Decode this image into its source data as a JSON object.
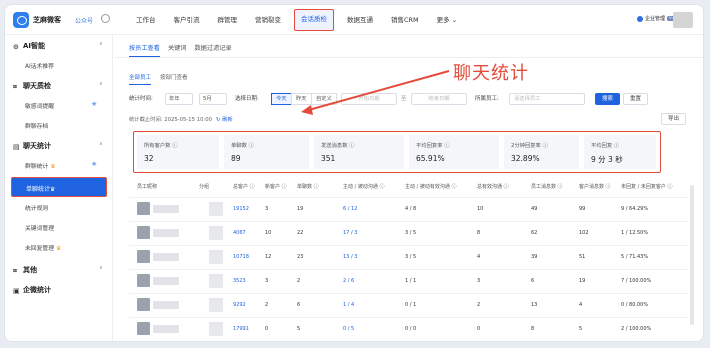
{
  "brand": {
    "name": "芝麻微客",
    "subtitle": "公众号"
  },
  "nav": [
    "工作台",
    "客户引流",
    "群管理",
    "营销裂变",
    "会话质检",
    "数据互通",
    "销售CRM",
    "更多 ⌄"
  ],
  "nav_active_index": 4,
  "user": {
    "name": "企业管理",
    "badge": "v3"
  },
  "sidebar": {
    "groups": [
      {
        "label": "AI智能",
        "items": [
          "AI话术推荐"
        ]
      },
      {
        "label": "聊天质检",
        "items": [
          "敏感词提醒",
          "群聊存档"
        ]
      },
      {
        "label": "聊天统计",
        "items": [
          "群聊统计",
          "单聊统计",
          "统计规则",
          "关键词管理",
          "未回复管理"
        ]
      },
      {
        "label": "其他",
        "items": []
      },
      {
        "label": "企微统计",
        "items": []
      }
    ],
    "active_item": "单聊统计"
  },
  "tabs": [
    "按员工查看",
    "关键词",
    "数据过滤记录"
  ],
  "subtabs": [
    "全部员工",
    "按部门查看"
  ],
  "filters": {
    "stat_time_label": "统计时间:",
    "granularity": "年年",
    "month": "5月",
    "date_label": "选择日期:",
    "day_buttons": [
      "今天",
      "昨天",
      "自定义"
    ],
    "start_placeholder": "开始日期",
    "date_sep": "至",
    "end_placeholder": "结束日期",
    "employee_label": "所属员工:",
    "employee_placeholder": "请选择员工",
    "search_btn": "搜索",
    "reset_btn": "重置"
  },
  "stat_time": {
    "text": "统计截止时间: 2025-05-15 10:00",
    "refresh": "刷新"
  },
  "export_btn": "导出",
  "stats": [
    {
      "label": "所有客户数 ⓘ",
      "value": "32"
    },
    {
      "label": "单聊数 ⓘ",
      "value": "89"
    },
    {
      "label": "发送消息数 ⓘ",
      "value": "351"
    },
    {
      "label": "平均回复率 ⓘ",
      "value": "65.91%"
    },
    {
      "label": "2分钟回复率 ⓘ",
      "value": "32.89%"
    },
    {
      "label": "平均回复 ⓘ",
      "value": "9 分 3 秒"
    }
  ],
  "annotation": "聊天统计",
  "table": {
    "headers": [
      "员工昵称",
      "分组",
      "总客户 ⓘ",
      "新客户 ⓘ",
      "单聊数 ⓘ",
      "主动 / 被动沟通 ⓘ",
      "主动 / 被动有效沟通 ⓘ",
      "总有效沟通 ⓘ",
      "员工消息数 ⓘ",
      "客户消息数 ⓘ",
      "未回复 / 未回复客户 ⓘ"
    ],
    "rows": [
      [
        "19152",
        "3",
        "19",
        "6 / 12",
        "4 / 8",
        "10",
        "49",
        "99",
        "9 / 64.29%"
      ],
      [
        "4067",
        "10",
        "22",
        "17 / 3",
        "3 / 5",
        "8",
        "62",
        "102",
        "1 / 12.50%"
      ],
      [
        "10718",
        "12",
        "23",
        "13 / 3",
        "3 / 5",
        "4",
        "39",
        "51",
        "5 / 71.43%"
      ],
      [
        "3523",
        "3",
        "2",
        "2 / 6",
        "1 / 1",
        "3",
        "6",
        "19",
        "7 / 100.00%"
      ],
      [
        "9292",
        "2",
        "6",
        "1 / 4",
        "0 / 1",
        "2",
        "13",
        "4",
        "0 / 80.00%"
      ],
      [
        "17991",
        "0",
        "5",
        "0 / 5",
        "0 / 0",
        "0",
        "8",
        "5",
        "2 / 100.00%"
      ]
    ]
  }
}
